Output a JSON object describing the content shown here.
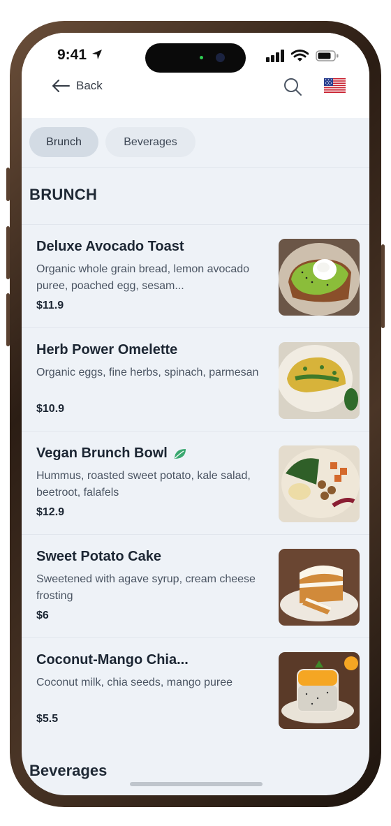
{
  "status_bar": {
    "time": "9:41"
  },
  "header": {
    "back_label": "Back",
    "search_icon": "search-icon",
    "language_flag": "us-flag-icon"
  },
  "tabs": [
    {
      "label": "Brunch",
      "active": true
    },
    {
      "label": "Beverages",
      "active": false
    }
  ],
  "sections": {
    "brunch_title": "BRUNCH",
    "beverages_title": "Beverages"
  },
  "items": [
    {
      "name": "Deluxe Avocado Toast",
      "description": "Organic whole grain bread, lemon avocado puree, poached egg, sesam...",
      "price": "$11.9",
      "vegan": false
    },
    {
      "name": "Herb Power Omelette",
      "description": "Organic eggs, fine herbs, spinach, parmesan",
      "price": "$10.9",
      "vegan": false
    },
    {
      "name": "Vegan Brunch Bowl",
      "description": "Hummus, roasted sweet potato, kale salad, beetroot, falafels",
      "price": "$12.9",
      "vegan": true
    },
    {
      "name": "Sweet Potato Cake",
      "description": "Sweetened with agave syrup, cream cheese frosting",
      "price": "$6",
      "vegan": false
    },
    {
      "name": "Coconut-Mango Chia...",
      "description": "Coconut milk, chia seeds, mango puree",
      "price": "$5.5",
      "vegan": false
    }
  ],
  "colors": {
    "background": "#eef2f7",
    "text_primary": "#1c2633",
    "vegan_leaf": "#3aa870",
    "active_chip": "#d3dbe4"
  }
}
